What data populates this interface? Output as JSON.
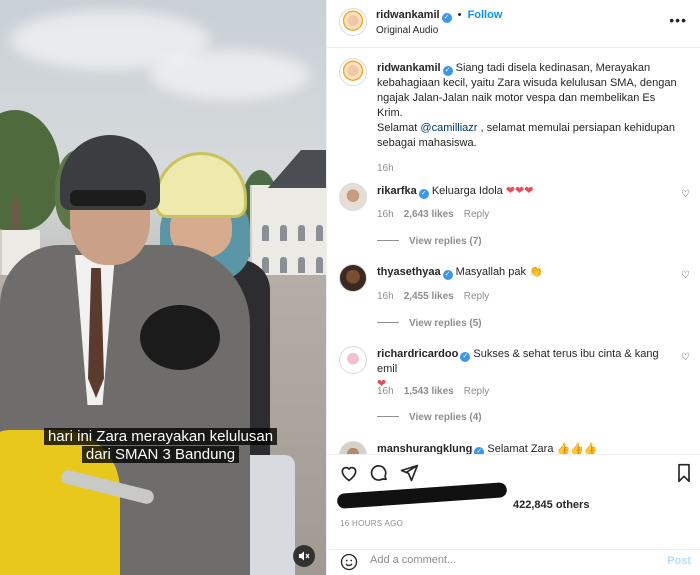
{
  "media": {
    "caption_line1": "hari ini Zara merayakan kelulusan",
    "caption_line2": "dari SMAN 3 Bandung",
    "mute_icon": "speaker-muted-icon"
  },
  "header": {
    "username": "ridwankamil",
    "follow_label": "Follow",
    "separator": "•",
    "audio": "Original Audio",
    "more_icon": "more-dots-icon"
  },
  "post": {
    "username": "ridwankamil",
    "caption_p1": "Siang tadi disela kedinasan, Merayakan kebahagiaan kecil, yaitu Zara wisuda kelulusan SMA, dengan ngajak Jalan-Jalan naik motor vespa dan membelikan Es Krim.",
    "caption_p2_before": "Selamat ",
    "caption_p2_mention": "@camilliazr",
    "caption_p2_after": " , selamat memulai persiapan kehidupan sebagai mahasiswa.",
    "time": "16h"
  },
  "comments": [
    {
      "username": "rikarfka",
      "text": "Keluarga Idola",
      "emoji": "❤❤❤",
      "time": "16h",
      "likes": "2,643 likes",
      "reply": "Reply",
      "view_replies": "View replies (7)"
    },
    {
      "username": "thyasethyaa",
      "text": "Masyallah pak",
      "emoji": "👏",
      "time": "16h",
      "likes": "2,455 likes",
      "reply": "Reply",
      "view_replies": "View replies (5)"
    },
    {
      "username": "richardricardoo",
      "text": "Sukses & sehat terus ibu cinta & kang emil",
      "emoji": "❤",
      "time": "16h",
      "likes": "1,543 likes",
      "reply": "Reply",
      "view_replies": "View replies (4)"
    },
    {
      "username": "manshurangklung",
      "text": "Selamat Zara",
      "emoji": "👍👍👍"
    }
  ],
  "actions": {
    "like_icon": "heart-outline-icon",
    "comment_icon": "comment-bubble-icon",
    "share_icon": "paper-plane-icon",
    "save_icon": "bookmark-icon",
    "likes_suffix": "422,845 others",
    "timestamp": "16 HOURS AGO"
  },
  "add_comment": {
    "emoji_icon": "smiley-icon",
    "placeholder": "Add a comment...",
    "post_label": "Post"
  },
  "colors": {
    "link": "#0095f6",
    "heart": "#ed4956",
    "muted": "#8e8e8e",
    "mention": "#00376b"
  }
}
